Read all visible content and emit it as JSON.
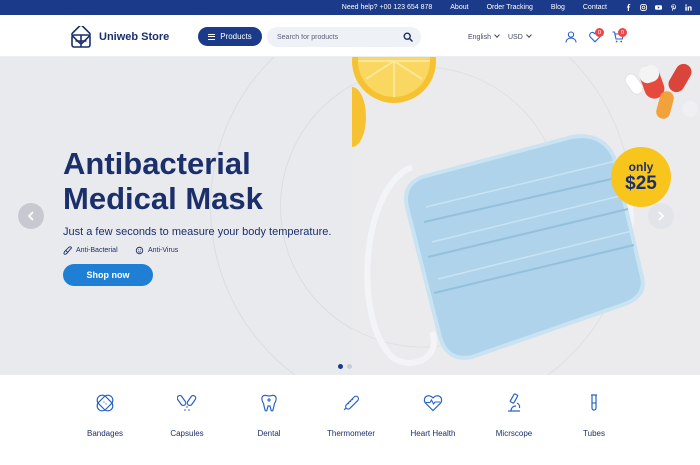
{
  "topbar": {
    "help": "Need help? +00 123 654 878",
    "links": [
      "About",
      "Order Tracking",
      "Blog",
      "Contact"
    ],
    "social_icons": [
      "facebook-icon",
      "instagram-icon",
      "youtube-icon",
      "pinterest-icon",
      "linkedin-icon"
    ]
  },
  "header": {
    "brand": "Uniweb Store",
    "products_label": "Products",
    "search_placeholder": "Search for products",
    "language": "English",
    "currency": "USD",
    "wishlist_count": "0",
    "cart_count": "0"
  },
  "hero": {
    "title_line1": "Antibacterial",
    "title_line2": "Medical Mask",
    "subtitle": "Just a few seconds to measure your body temperature.",
    "features": [
      "Anti-Bacterial",
      "Anti-Virus"
    ],
    "cta": "Shop now",
    "price_prefix": "only",
    "price": "$25",
    "slide_count": 2,
    "active_slide": 1
  },
  "categories": [
    {
      "label": "Bandages",
      "icon": "bandage-icon"
    },
    {
      "label": "Capsules",
      "icon": "capsules-icon"
    },
    {
      "label": "Dental",
      "icon": "tooth-icon"
    },
    {
      "label": "Thermometer",
      "icon": "thermometer-icon"
    },
    {
      "label": "Heart Health",
      "icon": "heart-icon"
    },
    {
      "label": "Micrscope",
      "icon": "microscope-icon"
    },
    {
      "label": "Tubes",
      "icon": "test-tube-icon"
    }
  ],
  "colors": {
    "brand_navy": "#1c3a8a",
    "text_navy": "#1b2f6b",
    "cta_blue": "#1e7fd5",
    "price_yellow": "#f8c51c",
    "badge_red": "#ec4747",
    "hero_bg": "#e9eaee"
  }
}
